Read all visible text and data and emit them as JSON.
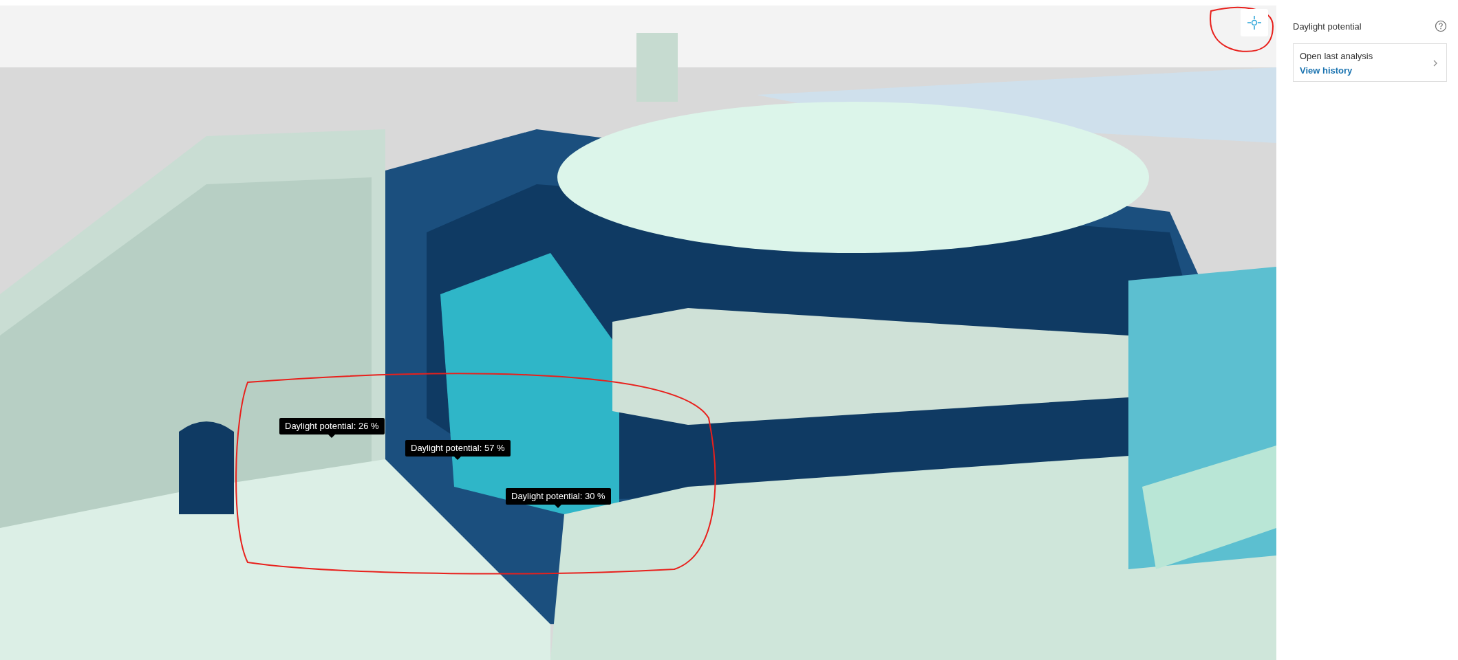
{
  "panel": {
    "title": "Daylight potential",
    "card": {
      "label": "Open last analysis",
      "link": "View history"
    }
  },
  "tooltips": [
    {
      "text": "Daylight potential: 26 %"
    },
    {
      "text": "Daylight potential: 57 %"
    },
    {
      "text": "Daylight potential: 30 %"
    }
  ]
}
